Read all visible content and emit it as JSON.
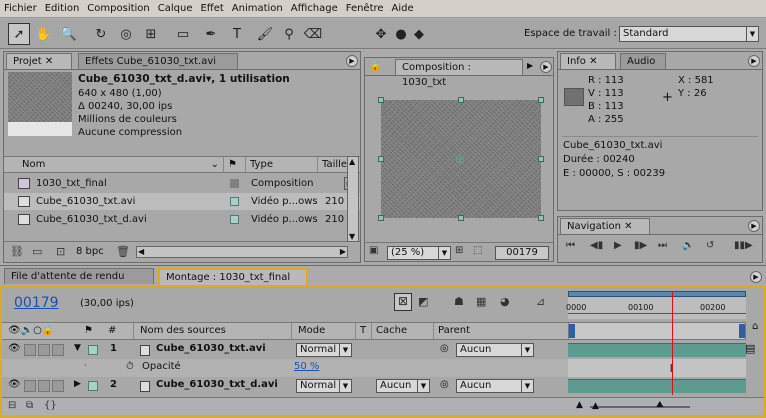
{
  "menu": [
    "Fichier",
    "Edition",
    "Composition",
    "Calque",
    "Effet",
    "Animation",
    "Affichage",
    "Fenêtre",
    "Aide"
  ],
  "workspace": {
    "label": "Espace de travail :",
    "value": "Standard"
  },
  "project": {
    "tabs": [
      "Projet",
      "Effets Cube_61030_txt.avi"
    ],
    "file_name": "Cube_61030_txt_d.avi",
    "usage": ", 1 utilisation",
    "dims": "640 x 480 (1,00)",
    "duration": "Δ 00240, 30,00 ips",
    "colors": "Millions de couleurs",
    "compression": "Aucune compression",
    "columns": [
      "Nom",
      "Type",
      "Taille"
    ],
    "items": [
      {
        "name": "1030_txt_final",
        "type": "Composition",
        "size": ""
      },
      {
        "name": "Cube_61030_txt.avi",
        "type": "Vidéo p...ows",
        "size": "210"
      },
      {
        "name": "Cube_61030_txt_d.avi",
        "type": "Vidéo p...ows",
        "size": "210"
      }
    ],
    "bpc": "8 bpc"
  },
  "composition": {
    "tab": "Composition : 1030_txt",
    "zoom": "(25 %)",
    "frame": "00179"
  },
  "info": {
    "tabs": [
      "Info",
      "Audio"
    ],
    "r": "R : 113",
    "v": "V : 113",
    "b": "B : 113",
    "a": "A : 255",
    "x": "X : 581",
    "y": "Y : 26",
    "file": "Cube_61030_txt.avi",
    "duree": "Durée : 00240",
    "es": "E : 00000, S : 00239",
    "swatch": "#717171"
  },
  "navigation": {
    "tab": "Navigation"
  },
  "timeline": {
    "tabs": [
      "File d'attente de rendu",
      "Montage : 1030_txt_final"
    ],
    "time": "00179",
    "fps": "(30,00 ips)",
    "ruler": [
      "0000",
      "00100",
      "00200"
    ],
    "columns": {
      "num": "#",
      "source": "Nom des sources",
      "mode": "Mode",
      "t": "T",
      "cache": "Cache",
      "parent": "Parent"
    },
    "layers": [
      {
        "num": "1",
        "name": "Cube_61030_txt.avi",
        "mode": "Normal",
        "cache": "",
        "parent": "Aucun"
      },
      {
        "num": "2",
        "name": "Cube_61030_txt_d.avi",
        "mode": "Normal",
        "cache": "Aucun",
        "parent": "Aucun"
      }
    ],
    "opacity": {
      "label": "Opacité",
      "value": "50 %"
    },
    "playhead_frame": 179,
    "ruler_max": 240
  }
}
